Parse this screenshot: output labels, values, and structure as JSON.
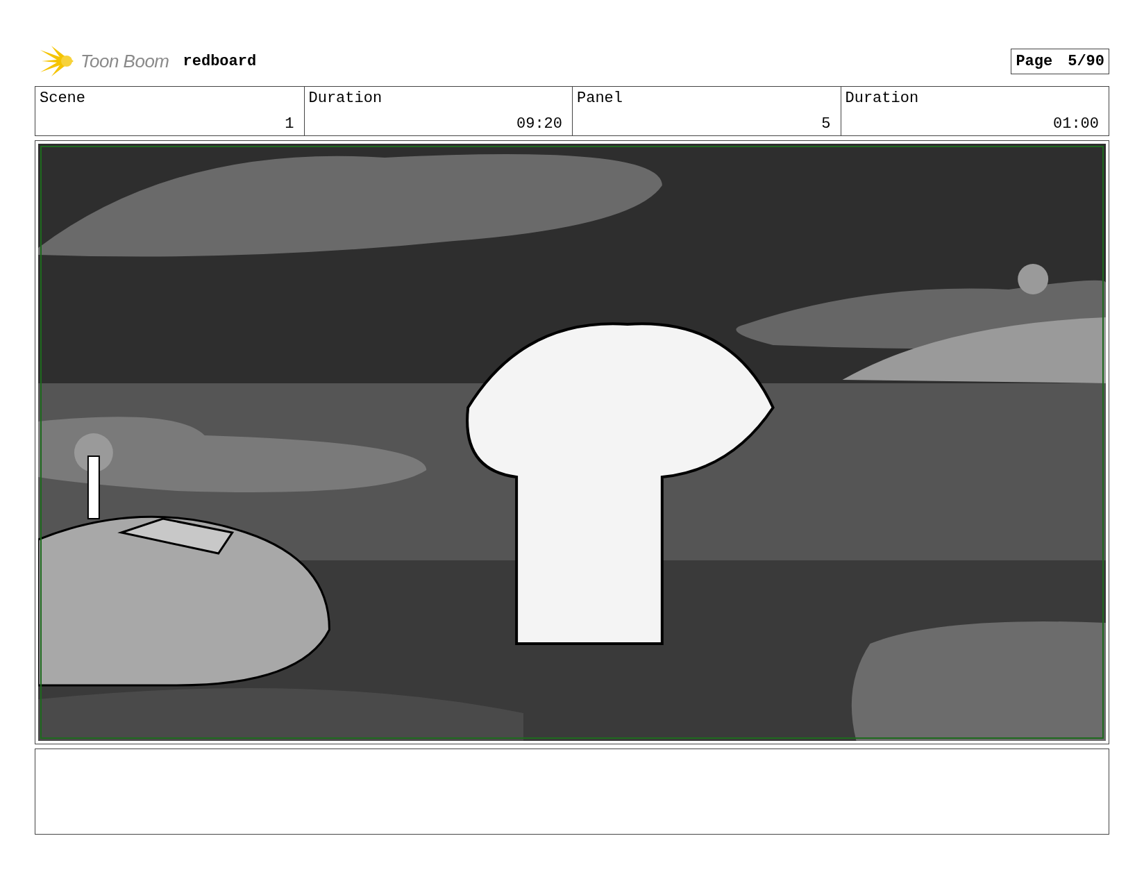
{
  "header": {
    "brand": "Toon Boom",
    "project": "redboard",
    "page_label": "Page",
    "page_number": "5/90"
  },
  "fields": [
    {
      "label": "Scene",
      "value": "1"
    },
    {
      "label": "Duration",
      "value": "09:20"
    },
    {
      "label": "Panel",
      "value": "5"
    },
    {
      "label": "Duration",
      "value": "01:00"
    }
  ]
}
